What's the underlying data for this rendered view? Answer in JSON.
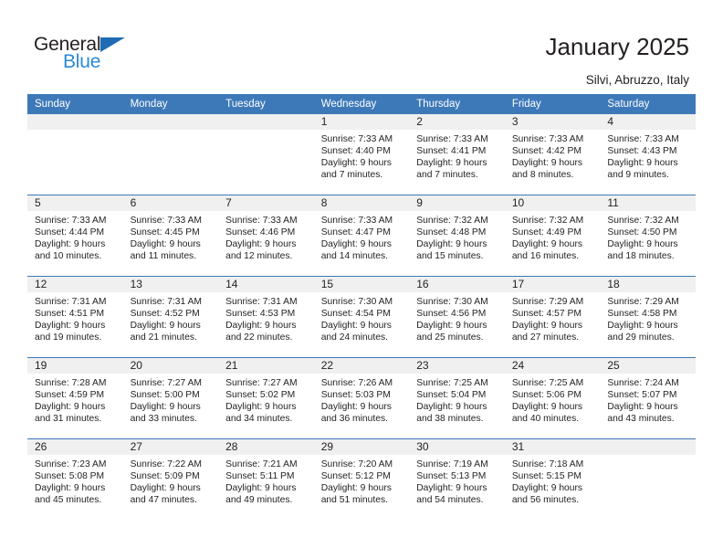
{
  "brand": {
    "name_dark": "General",
    "name_blue": "Blue",
    "accent_blue": "#3d79b8",
    "logo_blue": "#2b8bd4"
  },
  "header": {
    "title": "January 2025",
    "subtitle": "Silvi, Abruzzo, Italy"
  },
  "calendar": {
    "weekday_headers": [
      "Sunday",
      "Monday",
      "Tuesday",
      "Wednesday",
      "Thursday",
      "Friday",
      "Saturday"
    ],
    "weeks": [
      [
        {
          "day": "",
          "lines": []
        },
        {
          "day": "",
          "lines": []
        },
        {
          "day": "",
          "lines": []
        },
        {
          "day": "1",
          "lines": [
            "Sunrise: 7:33 AM",
            "Sunset: 4:40 PM",
            "Daylight: 9 hours",
            "and 7 minutes."
          ]
        },
        {
          "day": "2",
          "lines": [
            "Sunrise: 7:33 AM",
            "Sunset: 4:41 PM",
            "Daylight: 9 hours",
            "and 7 minutes."
          ]
        },
        {
          "day": "3",
          "lines": [
            "Sunrise: 7:33 AM",
            "Sunset: 4:42 PM",
            "Daylight: 9 hours",
            "and 8 minutes."
          ]
        },
        {
          "day": "4",
          "lines": [
            "Sunrise: 7:33 AM",
            "Sunset: 4:43 PM",
            "Daylight: 9 hours",
            "and 9 minutes."
          ]
        }
      ],
      [
        {
          "day": "5",
          "lines": [
            "Sunrise: 7:33 AM",
            "Sunset: 4:44 PM",
            "Daylight: 9 hours",
            "and 10 minutes."
          ]
        },
        {
          "day": "6",
          "lines": [
            "Sunrise: 7:33 AM",
            "Sunset: 4:45 PM",
            "Daylight: 9 hours",
            "and 11 minutes."
          ]
        },
        {
          "day": "7",
          "lines": [
            "Sunrise: 7:33 AM",
            "Sunset: 4:46 PM",
            "Daylight: 9 hours",
            "and 12 minutes."
          ]
        },
        {
          "day": "8",
          "lines": [
            "Sunrise: 7:33 AM",
            "Sunset: 4:47 PM",
            "Daylight: 9 hours",
            "and 14 minutes."
          ]
        },
        {
          "day": "9",
          "lines": [
            "Sunrise: 7:32 AM",
            "Sunset: 4:48 PM",
            "Daylight: 9 hours",
            "and 15 minutes."
          ]
        },
        {
          "day": "10",
          "lines": [
            "Sunrise: 7:32 AM",
            "Sunset: 4:49 PM",
            "Daylight: 9 hours",
            "and 16 minutes."
          ]
        },
        {
          "day": "11",
          "lines": [
            "Sunrise: 7:32 AM",
            "Sunset: 4:50 PM",
            "Daylight: 9 hours",
            "and 18 minutes."
          ]
        }
      ],
      [
        {
          "day": "12",
          "lines": [
            "Sunrise: 7:31 AM",
            "Sunset: 4:51 PM",
            "Daylight: 9 hours",
            "and 19 minutes."
          ]
        },
        {
          "day": "13",
          "lines": [
            "Sunrise: 7:31 AM",
            "Sunset: 4:52 PM",
            "Daylight: 9 hours",
            "and 21 minutes."
          ]
        },
        {
          "day": "14",
          "lines": [
            "Sunrise: 7:31 AM",
            "Sunset: 4:53 PM",
            "Daylight: 9 hours",
            "and 22 minutes."
          ]
        },
        {
          "day": "15",
          "lines": [
            "Sunrise: 7:30 AM",
            "Sunset: 4:54 PM",
            "Daylight: 9 hours",
            "and 24 minutes."
          ]
        },
        {
          "day": "16",
          "lines": [
            "Sunrise: 7:30 AM",
            "Sunset: 4:56 PM",
            "Daylight: 9 hours",
            "and 25 minutes."
          ]
        },
        {
          "day": "17",
          "lines": [
            "Sunrise: 7:29 AM",
            "Sunset: 4:57 PM",
            "Daylight: 9 hours",
            "and 27 minutes."
          ]
        },
        {
          "day": "18",
          "lines": [
            "Sunrise: 7:29 AM",
            "Sunset: 4:58 PM",
            "Daylight: 9 hours",
            "and 29 minutes."
          ]
        }
      ],
      [
        {
          "day": "19",
          "lines": [
            "Sunrise: 7:28 AM",
            "Sunset: 4:59 PM",
            "Daylight: 9 hours",
            "and 31 minutes."
          ]
        },
        {
          "day": "20",
          "lines": [
            "Sunrise: 7:27 AM",
            "Sunset: 5:00 PM",
            "Daylight: 9 hours",
            "and 33 minutes."
          ]
        },
        {
          "day": "21",
          "lines": [
            "Sunrise: 7:27 AM",
            "Sunset: 5:02 PM",
            "Daylight: 9 hours",
            "and 34 minutes."
          ]
        },
        {
          "day": "22",
          "lines": [
            "Sunrise: 7:26 AM",
            "Sunset: 5:03 PM",
            "Daylight: 9 hours",
            "and 36 minutes."
          ]
        },
        {
          "day": "23",
          "lines": [
            "Sunrise: 7:25 AM",
            "Sunset: 5:04 PM",
            "Daylight: 9 hours",
            "and 38 minutes."
          ]
        },
        {
          "day": "24",
          "lines": [
            "Sunrise: 7:25 AM",
            "Sunset: 5:06 PM",
            "Daylight: 9 hours",
            "and 40 minutes."
          ]
        },
        {
          "day": "25",
          "lines": [
            "Sunrise: 7:24 AM",
            "Sunset: 5:07 PM",
            "Daylight: 9 hours",
            "and 43 minutes."
          ]
        }
      ],
      [
        {
          "day": "26",
          "lines": [
            "Sunrise: 7:23 AM",
            "Sunset: 5:08 PM",
            "Daylight: 9 hours",
            "and 45 minutes."
          ]
        },
        {
          "day": "27",
          "lines": [
            "Sunrise: 7:22 AM",
            "Sunset: 5:09 PM",
            "Daylight: 9 hours",
            "and 47 minutes."
          ]
        },
        {
          "day": "28",
          "lines": [
            "Sunrise: 7:21 AM",
            "Sunset: 5:11 PM",
            "Daylight: 9 hours",
            "and 49 minutes."
          ]
        },
        {
          "day": "29",
          "lines": [
            "Sunrise: 7:20 AM",
            "Sunset: 5:12 PM",
            "Daylight: 9 hours",
            "and 51 minutes."
          ]
        },
        {
          "day": "30",
          "lines": [
            "Sunrise: 7:19 AM",
            "Sunset: 5:13 PM",
            "Daylight: 9 hours",
            "and 54 minutes."
          ]
        },
        {
          "day": "31",
          "lines": [
            "Sunrise: 7:18 AM",
            "Sunset: 5:15 PM",
            "Daylight: 9 hours",
            "and 56 minutes."
          ]
        },
        {
          "day": "",
          "lines": []
        }
      ]
    ]
  }
}
